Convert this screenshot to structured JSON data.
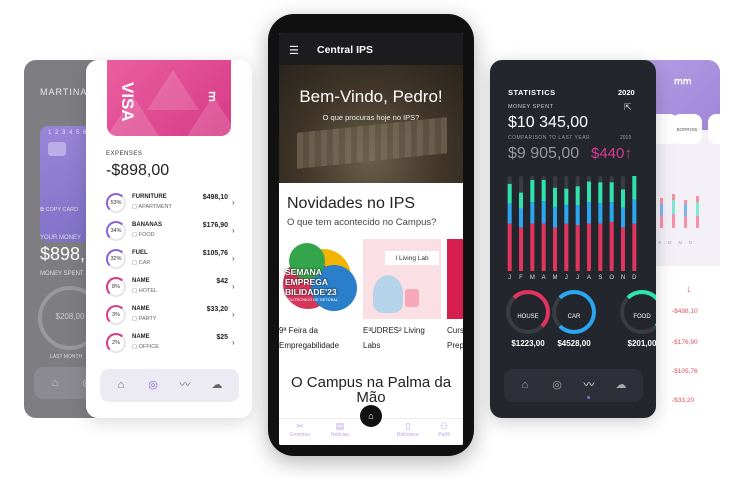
{
  "grey_card": {
    "user_name": "MARTINA W",
    "card_number": "1 2 3 4  5 6",
    "copy_card_label": "COPY CARD",
    "money_label": "YOUR MONEY",
    "money_value": "$898,",
    "spent_label": "MONEY SPENT",
    "ring_value": "$208,00",
    "last_month_label": "LAST MONTH"
  },
  "expenses_card": {
    "card_brand": "VISA",
    "label": "EXPENSES",
    "total": "-$898,00",
    "items": [
      {
        "percent": "53%",
        "name": "FURNITURE",
        "category": "APARTMENT",
        "amount": "$498,10",
        "color": "#8b5fd6"
      },
      {
        "percent": "34%",
        "name": "BANANAS",
        "category": "FOOD",
        "amount": "$176,90",
        "color": "#8b5fd6"
      },
      {
        "percent": "32%",
        "name": "FUEL",
        "category": "CAR",
        "amount": "$105,76",
        "color": "#8b5fd6"
      },
      {
        "percent": "8%",
        "name": "NAME",
        "category": "HOTEL",
        "amount": "$42",
        "color": "#d63a86"
      },
      {
        "percent": "3%",
        "name": "NAME",
        "category": "PARTY",
        "amount": "$33,20",
        "color": "#d63a86"
      },
      {
        "percent": "2%",
        "name": "NAME",
        "category": "OFFICE",
        "amount": "$25",
        "color": "#d63a86"
      }
    ]
  },
  "phone": {
    "app_title": "Central IPS",
    "welcome": "Bem-Vindo, Pedro!",
    "welcome_sub": "O que procuras hoje no IPS?",
    "news_title": "Novidades no IPS",
    "news_sub": "O que tem acontecido no Campus?",
    "thumb1_text": "SEMANA EMPREGA BILIDADE'23",
    "thumb1_small": "POLITÉCNICO DE SETÚBAL",
    "thumb2_text": "I Living Lab",
    "captions": [
      "9ª Feira da Empregabilidade",
      "E³UDRES² Living Labs",
      "Curs Prep"
    ],
    "campus_title": "O Campus na Palma da Mão",
    "nav": [
      "Ementas",
      "Notícias",
      "Biblioteca",
      "Perfil"
    ]
  },
  "stats_card": {
    "title": "STATISTICS",
    "year": "2020",
    "money_spent_label": "MONEY SPENT",
    "money_spent": "$10 345,00",
    "comparison_label": "COMPARISON TO LAST YEAR",
    "comparison_year": "2019",
    "comparison_value": "$9 905,00",
    "difference": "$440",
    "categories": [
      {
        "label": "HOUSE",
        "value": "$1223,00",
        "color": "#e2345f"
      },
      {
        "label": "CAR",
        "value": "$4528,00",
        "color": "#2aa7f0"
      },
      {
        "label": "FOOD",
        "value": "$201,00",
        "color": "#2fe3b0"
      }
    ]
  },
  "back_card": {
    "pill_labels": [
      "",
      "BORROW",
      ""
    ],
    "months": [
      "S",
      "O",
      "N",
      "D"
    ],
    "amounts": [
      "-$498,10",
      "-$176,90",
      "-$105,76",
      "-$33,20"
    ]
  },
  "chart_data": {
    "type": "bar",
    "categories": [
      "J",
      "F",
      "M",
      "A",
      "M",
      "J",
      "J",
      "A",
      "S",
      "O",
      "N",
      "D"
    ],
    "series": [
      {
        "values": [
          60,
          55,
          60,
          60,
          55,
          60,
          58,
          60,
          60,
          62,
          55,
          60
        ],
        "color": "#e2345f"
      },
      {
        "values": [
          25,
          24,
          27,
          28,
          26,
          24,
          25,
          27,
          26,
          25,
          25,
          30
        ],
        "color": "#2aa7f0"
      },
      {
        "values": [
          25,
          20,
          28,
          27,
          24,
          20,
          24,
          26,
          26,
          25,
          23,
          30
        ],
        "color": "#2fe3b0"
      }
    ],
    "ylim": [
      0,
      120
    ]
  }
}
